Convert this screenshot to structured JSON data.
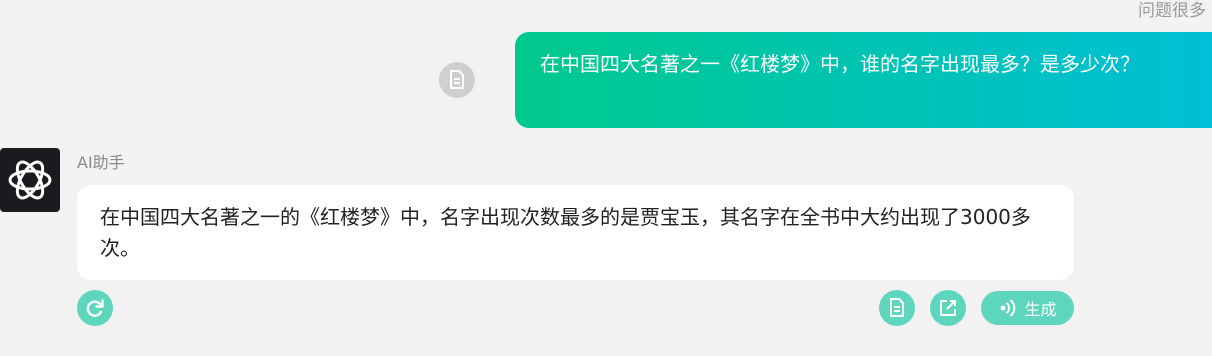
{
  "header": {
    "corner_label": "问题很多"
  },
  "user_message": {
    "text": "在中国四大名著之一《红楼梦》中，谁的名字出现最多？是多少次？"
  },
  "assistant": {
    "name": "AI助手",
    "message": "在中国四大名著之一的《红楼梦》中，名字出现次数最多的是贾宝玉，其名字在全书中大约出现了3000多次。"
  },
  "actions": {
    "generate_label": "生成"
  },
  "icons": {
    "user_doc": "document-icon",
    "avatar": "openai-logo-icon",
    "refresh": "refresh-icon",
    "doc": "document-icon",
    "open_external": "open-external-icon",
    "voice": "voice-wave-icon"
  },
  "colors": {
    "user_gradient_start": "#00c98d",
    "user_gradient_end": "#00bfd6",
    "teal_button": "#5ed6bd",
    "page_bg": "#f2f2f2"
  }
}
